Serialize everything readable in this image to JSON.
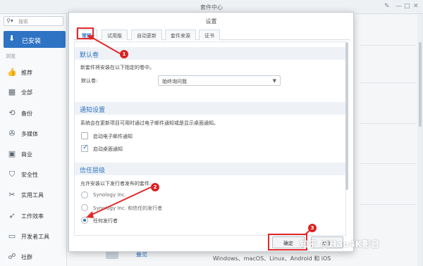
{
  "window": {
    "title": "套件中心"
  },
  "sidebar": {
    "search_placeholder": "搜索",
    "installed_label": "已安装",
    "section_label": "浏览",
    "items": [
      {
        "label": "推荐",
        "icon": "thumbs-up-icon"
      },
      {
        "label": "全部",
        "icon": "grid-icon"
      },
      {
        "label": "备份",
        "icon": "backup-icon"
      },
      {
        "label": "多媒体",
        "icon": "film-reel-icon"
      },
      {
        "label": "商业",
        "icon": "briefcase-icon"
      },
      {
        "label": "安全性",
        "icon": "shield-icon"
      },
      {
        "label": "实用工具",
        "icon": "tools-icon"
      },
      {
        "label": "工作效率",
        "icon": "rocket-icon"
      },
      {
        "label": "开发者工具",
        "icon": "terminal-icon"
      },
      {
        "label": "社群",
        "icon": "community-icon"
      }
    ]
  },
  "dialog": {
    "title": "设置",
    "tabs": [
      "常规",
      "试用版",
      "自动更新",
      "套件来源",
      "证书"
    ],
    "default_volume": {
      "header": "默认卷",
      "description": "新套件将安装在以下指定的卷中。",
      "field_label": "默认卷:",
      "value": "始终询问我"
    },
    "notification": {
      "header": "通知设置",
      "description": "系统会在更新项目可用时通过电子邮件通知或是显示桌面通知。",
      "options": [
        {
          "label": "启动电子邮件通知",
          "checked": false
        },
        {
          "label": "启动桌面通知",
          "checked": true
        }
      ]
    },
    "trust": {
      "header": "信任层级",
      "description": "允许安装以下发行者发布的套件:",
      "options": [
        {
          "label": "Synology Inc.",
          "selected": false
        },
        {
          "label": "Synology Inc. 和信任的发行者",
          "selected": false
        },
        {
          "label": "任何发行者",
          "selected": true
        }
      ]
    },
    "ok_label": "确定",
    "cancel_label": "取消"
  },
  "background": {
    "bottom_app_label": "叠览",
    "bottom_text": "Windows、macOS、Linux、Android 和 iOS"
  },
  "annotations": [
    "1",
    "2",
    "3"
  ],
  "watermark": "知乎 @Hao4K影音",
  "colors": {
    "accent": "#2e73c4",
    "annotation": "#e12a2a"
  }
}
